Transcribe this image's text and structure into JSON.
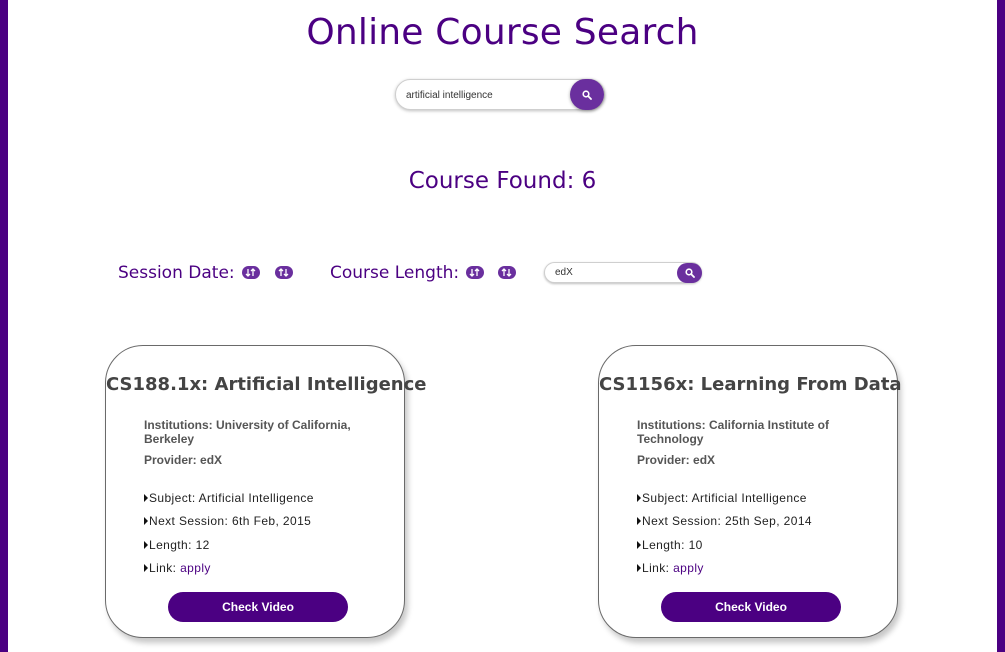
{
  "page": {
    "title": "Online Course Search",
    "accent": "#4b0082",
    "button_color": "#6a2f9e"
  },
  "search": {
    "value": "artificial intelligence",
    "icon": "search-icon"
  },
  "results": {
    "label": "Course Found: 6"
  },
  "filters": {
    "session_label": "Session Date:",
    "length_label": "Course Length:",
    "sort_icons": [
      "sort-asc-icon",
      "sort-desc-icon"
    ],
    "provider_value": "edX"
  },
  "courses": [
    {
      "title": "CS188.1x: Artificial Intelligence",
      "institutions": "Institutions: University of California, Berkeley",
      "provider": "Provider: edX",
      "subject": "Subject: Artificial Intelligence",
      "next_session": "Next Session: 6th Feb, 2015",
      "length": "Length: 12",
      "link_label": "Link:",
      "link_text": "apply",
      "button": "Check Video"
    },
    {
      "title": "CS1156x: Learning From Data",
      "institutions": "Institutions: California Institute of Technology",
      "provider": "Provider: edX",
      "subject": "Subject: Artificial Intelligence",
      "next_session": "Next Session: 25th Sep, 2014",
      "length": "Length: 10",
      "link_label": "Link:",
      "link_text": "apply",
      "button": "Check Video"
    }
  ]
}
